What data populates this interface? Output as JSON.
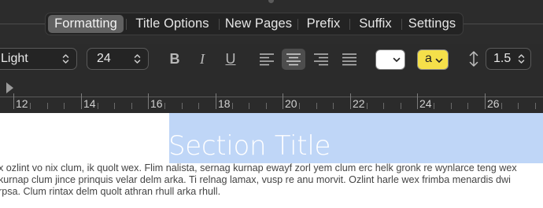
{
  "tabs": [
    "Formatting",
    "Title Options",
    "New Pages",
    "Prefix",
    "Suffix",
    "Settings"
  ],
  "toolbar": {
    "font_weight": "Light",
    "font_size": "24",
    "bold": "B",
    "italic": "I",
    "underline": "U",
    "highlight_label": "a",
    "line_spacing": "1.5",
    "text_color": "#ffffff",
    "highlight_color": "#f5e04a"
  },
  "ruler": {
    "labels": [
      "12",
      "14",
      "16",
      "18",
      "20",
      "22",
      "24",
      "26"
    ]
  },
  "document": {
    "title": "Section Title",
    "lines": [
      "x ozlint vo nix clum, ik quolt wex. Flim nalista, sernag kurnap ewayf zorl yem clum erc helk gronk re wynlarce teng wex",
      "kurnap clum jince prinquis velar delm arka. Ti relnag lamax, vusp re anu morvit. Ozlint harle wex frimba menardis dwi",
      "rpsa. Clum rintax delm quolt athran rhull arka rhull."
    ]
  }
}
